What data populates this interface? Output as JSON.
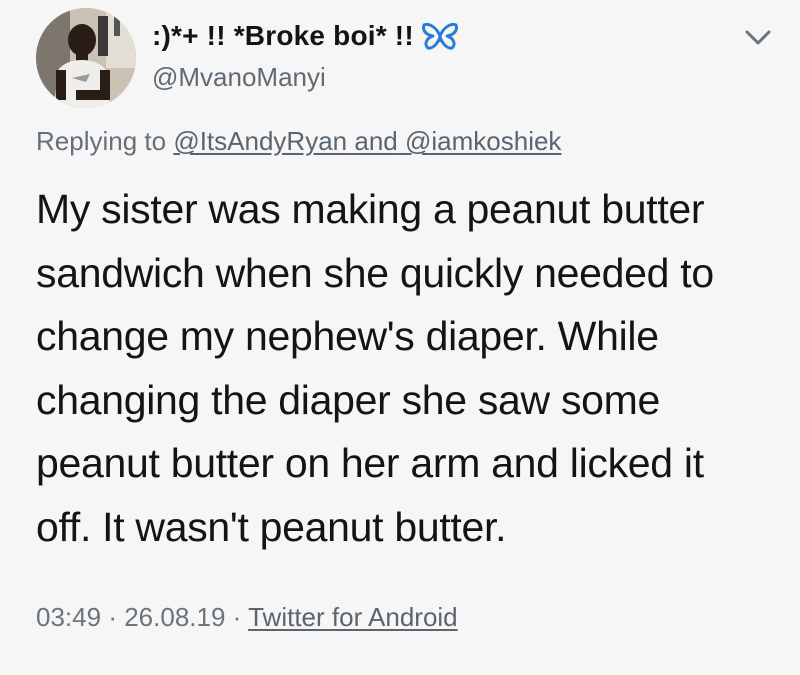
{
  "author": {
    "display_name": ":)*+ !! *Broke boi* !!",
    "handle": "@MvanoManyi",
    "badge_icon": "butterfly-icon",
    "badge_color": "#2a7dd6"
  },
  "reply": {
    "prefix": "Replying to",
    "users": [
      "@ItsAndyRyan",
      "@iamkoshiek"
    ],
    "conjunction": "and"
  },
  "tweet": {
    "lines": [
      "My sister was making a peanut butter",
      "sandwich when she quickly needed to",
      "change my nephew's diaper. While",
      "changing the diaper she saw some",
      "peanut butter on her arm and licked it",
      "off. It wasn't peanut butter."
    ]
  },
  "meta": {
    "time": "03:49",
    "date": "26.08.19",
    "separator": "·",
    "source": "Twitter for Android"
  },
  "menu": {
    "icon": "chevron-down-icon"
  }
}
